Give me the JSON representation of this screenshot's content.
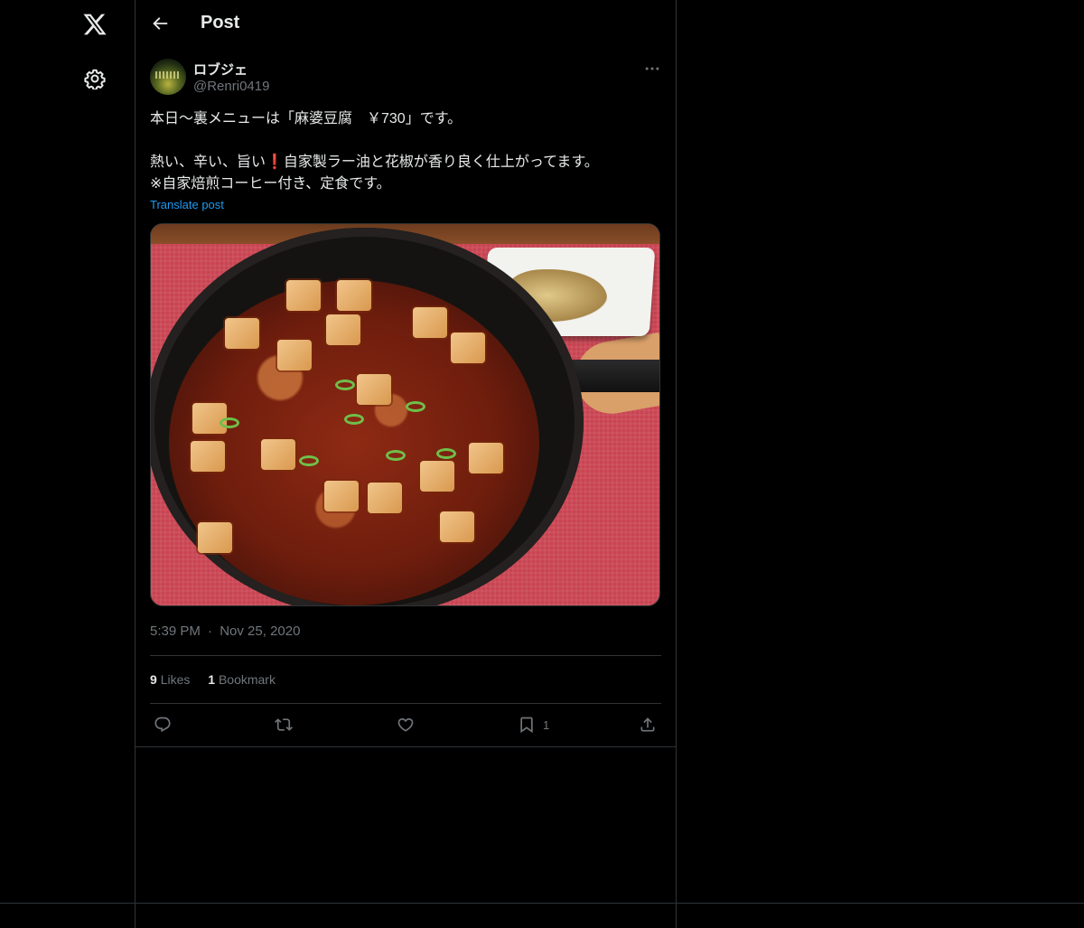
{
  "nav": {
    "logo": "x-logo",
    "settings": "gear-icon"
  },
  "header": {
    "title": "Post",
    "back": "back-arrow-icon"
  },
  "post": {
    "author": {
      "display_name": "ロブジェ",
      "handle": "@Renri0419"
    },
    "text": "本日〜裏メニューは「麻婆豆腐　￥730」です。\n\n熱い、辛い、旨い❗自家製ラー油と花椒が香り良く仕上がってます。\n※自家焙煎コーヒー付き、定食です。",
    "translate_label": "Translate post",
    "time": "5:39 PM",
    "separator": "·",
    "date": "Nov 25, 2020",
    "likes_count": "9",
    "likes_label": "Likes",
    "bookmarks_count": "1",
    "bookmarks_label": "Bookmark",
    "bookmark_action_count": "1"
  },
  "colors": {
    "background": "#000000",
    "text": "#e7e9ea",
    "muted": "#71767b",
    "link": "#1d9bf0",
    "border": "#2f3336"
  }
}
